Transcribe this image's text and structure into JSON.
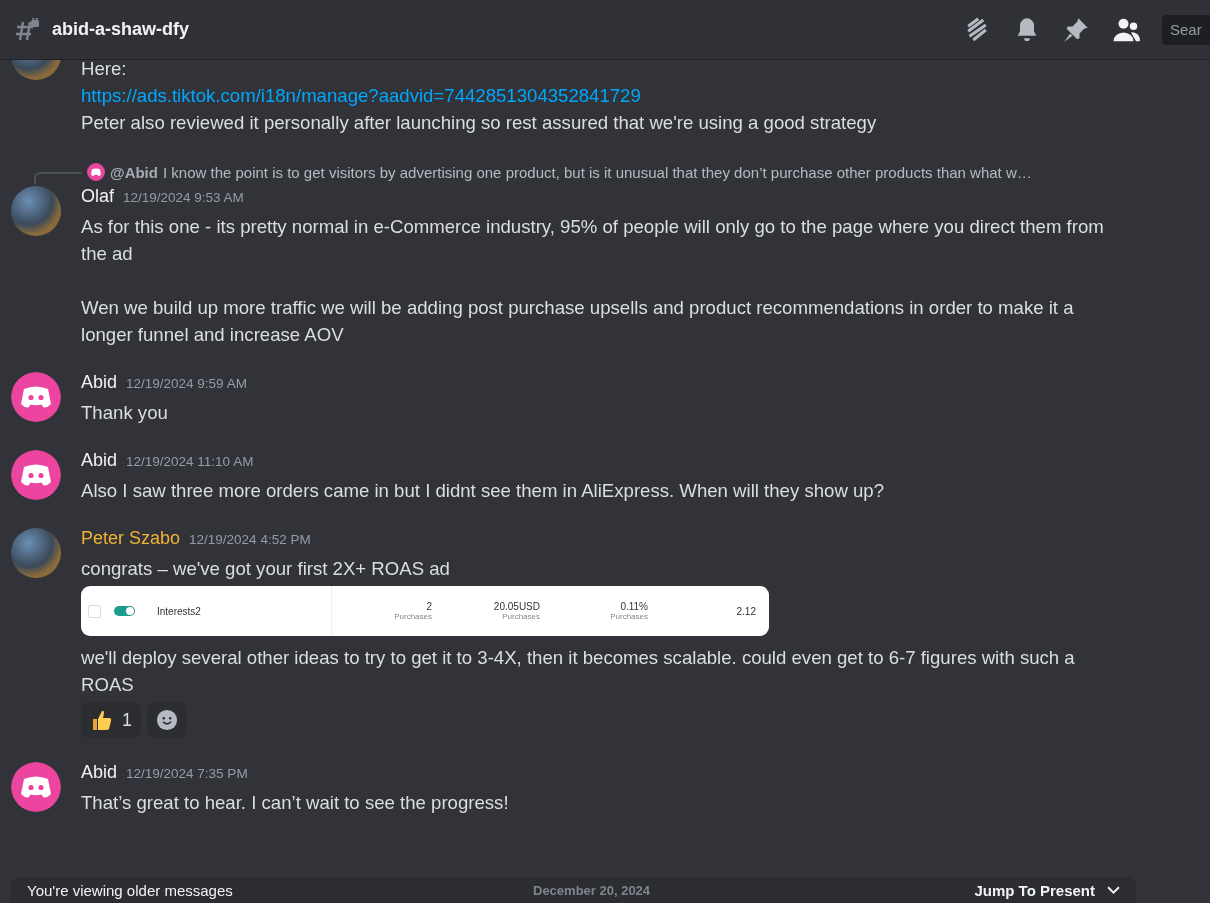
{
  "channel": {
    "name": "abid-a-shaw-dfy"
  },
  "search": {
    "placeholder": "Sear"
  },
  "messages": [
    {
      "kind": "continuation",
      "avatar": {
        "kind": "photo"
      },
      "paragraphs": [
        [
          {
            "kind": "text",
            "text": "Here:"
          },
          {
            "kind": "link",
            "text": "https://ads.tiktok.com/i18n/manage?aadvid=7442851304352841729"
          },
          {
            "kind": "text",
            "text": "Peter also reviewed it personally after launching so rest assured that we're using a good strategy"
          }
        ]
      ]
    },
    {
      "kind": "message",
      "avatar": {
        "kind": "photo"
      },
      "author": "Olaf",
      "color": "#f2f3f5",
      "timestamp": "12/19/2024 9:53 AM",
      "reply": {
        "mention": "@Abid",
        "text": "I know the point is to get visitors by advertising one product, but is it unusual that they don’t purchase other products than what w…"
      },
      "paragraphs": [
        [
          {
            "kind": "text",
            "text": "As for this one - its pretty normal in e-Commerce industry, 95% of people will only go to the page where you direct them from the ad"
          }
        ],
        [
          {
            "kind": "text",
            "text": "Wen we build up more traffic we will be adding post purchase upsells and product recommendations in order to make it a longer funnel and increase AOV"
          }
        ]
      ]
    },
    {
      "kind": "message",
      "avatar": {
        "kind": "discord"
      },
      "author": "Abid",
      "color": "#f2f3f5",
      "timestamp": "12/19/2024 9:59 AM",
      "paragraphs": [
        [
          {
            "kind": "text",
            "text": "Thank you"
          }
        ]
      ]
    },
    {
      "kind": "message",
      "avatar": {
        "kind": "discord"
      },
      "author": "Abid",
      "color": "#f2f3f5",
      "timestamp": "12/19/2024 11:10 AM",
      "paragraphs": [
        [
          {
            "kind": "text",
            "text": "Also I saw three more orders came in but I didnt see them in AliExpress. When will they show up?"
          }
        ]
      ]
    },
    {
      "kind": "message",
      "avatar": {
        "kind": "photo"
      },
      "author": "Peter Szabo",
      "color": "#f0b232",
      "timestamp": "12/19/2024 4:52 PM",
      "paragraphs": [
        [
          {
            "kind": "text",
            "text": "congrats – we've got your first 2X+ ROAS ad"
          }
        ]
      ],
      "embed": {
        "checked": false,
        "on": true,
        "name": "Interests2",
        "cells": [
          {
            "value": "2",
            "label": "Purchases"
          },
          {
            "value": "20.05USD",
            "label": "Purchases"
          },
          {
            "value": "0.11%",
            "label": "Purchases"
          },
          {
            "value": "2.12"
          }
        ]
      },
      "after": [
        [
          {
            "kind": "text",
            "text": "we'll deploy several other ideas to try to get it to 3-4X, then it becomes scalable. could even get to 6-7 figures with such a ROAS"
          }
        ]
      ],
      "reactions": [
        {
          "kind": "thumbs-up",
          "count": "1"
        },
        {
          "kind": "add"
        }
      ]
    },
    {
      "kind": "message",
      "avatar": {
        "kind": "discord"
      },
      "author": "Abid",
      "color": "#f2f3f5",
      "timestamp": "12/19/2024 7:35 PM",
      "paragraphs": [
        [
          {
            "kind": "text",
            "text": "That’s great to hear. I can’t wait to see the progress!"
          }
        ]
      ]
    }
  ],
  "bottom_bar": {
    "text": "You're viewing older messages",
    "date_divider": "December 20, 2024",
    "button": "Jump To Present"
  }
}
